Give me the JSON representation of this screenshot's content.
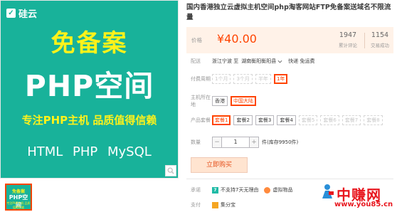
{
  "image": {
    "brand": "硅云",
    "headline": "免备案",
    "product": "PHP空间",
    "slogan": "专注PHP主机 品质值得信赖",
    "tech": "HTML PHP MySQL",
    "thumb_headline": "免备案",
    "thumb_product": "PHP空间",
    "thumb_slogan": "专注PHP主机 品质值得信赖"
  },
  "product": {
    "title": "国内香港独立云虚拟主机空间php淘客网站FTP免备案送域名不限流量",
    "price_label": "价格",
    "price": "¥40.00",
    "stats": [
      {
        "value": "1947",
        "label": "累计评论"
      },
      {
        "value": "1154",
        "label": "交易成功"
      }
    ]
  },
  "delivery": {
    "label": "配送",
    "from": "浙江宁波 至",
    "to": "湖南衡阳衡阳县",
    "shipping": "快递 免运费"
  },
  "period": {
    "label": "付费周期",
    "options": [
      "1个月",
      "3个月",
      "半年",
      "1年"
    ]
  },
  "location": {
    "label": "主机所在地",
    "options": [
      "香港",
      "中国大陆"
    ]
  },
  "package": {
    "label": "产品套餐",
    "options": [
      "套餐1",
      "套餐2",
      "套餐3",
      "套餐4",
      "套餐5",
      "套餐6",
      "套餐7",
      "套餐8"
    ]
  },
  "quantity": {
    "label": "数量",
    "minus": "−",
    "value": "1",
    "plus": "+",
    "stock": "件(库存9950件)"
  },
  "buy_button": "立即购买",
  "promise": {
    "label": "承诺",
    "items": [
      "不支持7天无理由",
      "虚拟物品"
    ]
  },
  "payment": {
    "label": "支付",
    "items": [
      "集分宝"
    ]
  },
  "watermark": {
    "title": "中赚网",
    "url": "www.you85.cn"
  },
  "colors": {
    "accent": "#ff4400",
    "image_bg": "#18b29a",
    "highlight_yellow": "#fff21a",
    "price_bg": "#fff2e8",
    "watermark": "#e8161e"
  }
}
